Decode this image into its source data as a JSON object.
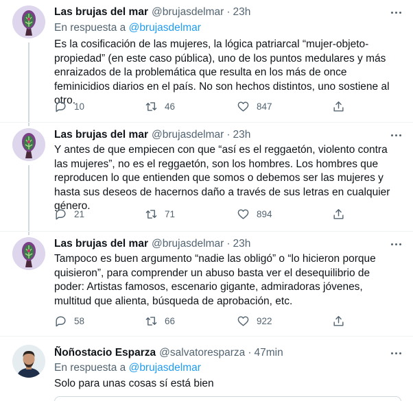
{
  "tweets": [
    {
      "name": "Las brujas del mar",
      "handle": "@brujasdelmar",
      "time": "23h",
      "reply_prefix": "En respuesta a",
      "reply_handle": "@brujasdelmar",
      "text": "Es la cosificación de las mujeres, la lógica patriarcal “mujer-objeto-propiedad” (en este caso pública), uno de los puntos medulares y más enraizados de la problemática que resulta en los más de once feminicidios diarios en el país. No son hechos distintos, uno sostiene al otro.",
      "replies": "10",
      "retweets": "46",
      "likes": "847"
    },
    {
      "name": "Las brujas del mar",
      "handle": "@brujasdelmar",
      "time": "23h",
      "text": "Y antes de que empiecen con que “así es el reggaetón, violento contra las mujeres”, no es el reggaetón, son los hombres. Los hombres que reproducen lo que entienden que somos o debemos ser las mujeres y hasta sus deseos de hacernos daño a través de sus letras en cualquier género.",
      "replies": "21",
      "retweets": "71",
      "likes": "894"
    },
    {
      "name": "Las brujas del mar",
      "handle": "@brujasdelmar",
      "time": "23h",
      "text": "Tampoco es buen argumento “nadie las obligó” o “lo hicieron porque quisieron”, para comprender un abuso basta ver el desequilibrio de poder: Artistas famosos, escenario gigante, admiradoras jóvenes, multitud que alienta, búsqueda de aprobación, etc.",
      "replies": "58",
      "retweets": "66",
      "likes": "922"
    },
    {
      "name": "Ñoñostacio Esparza",
      "handle": "@salvatoresparza",
      "time": "47min",
      "reply_prefix": "En respuesta a",
      "reply_handle": "@brujasdelmar",
      "text": "Solo para unas cosas sí está bien"
    }
  ],
  "separator": "·",
  "colors": {
    "text": "#0f1419",
    "secondary": "#536471",
    "link": "#1d9bf0",
    "divider": "#eff3f4",
    "thread_line": "#cfd9de",
    "avatar_bg": "#ddd6ec"
  },
  "icons": {
    "reply": "reply-icon",
    "retweet": "retweet-icon",
    "like": "heart-icon",
    "share": "share-icon",
    "more": "more-icon"
  }
}
